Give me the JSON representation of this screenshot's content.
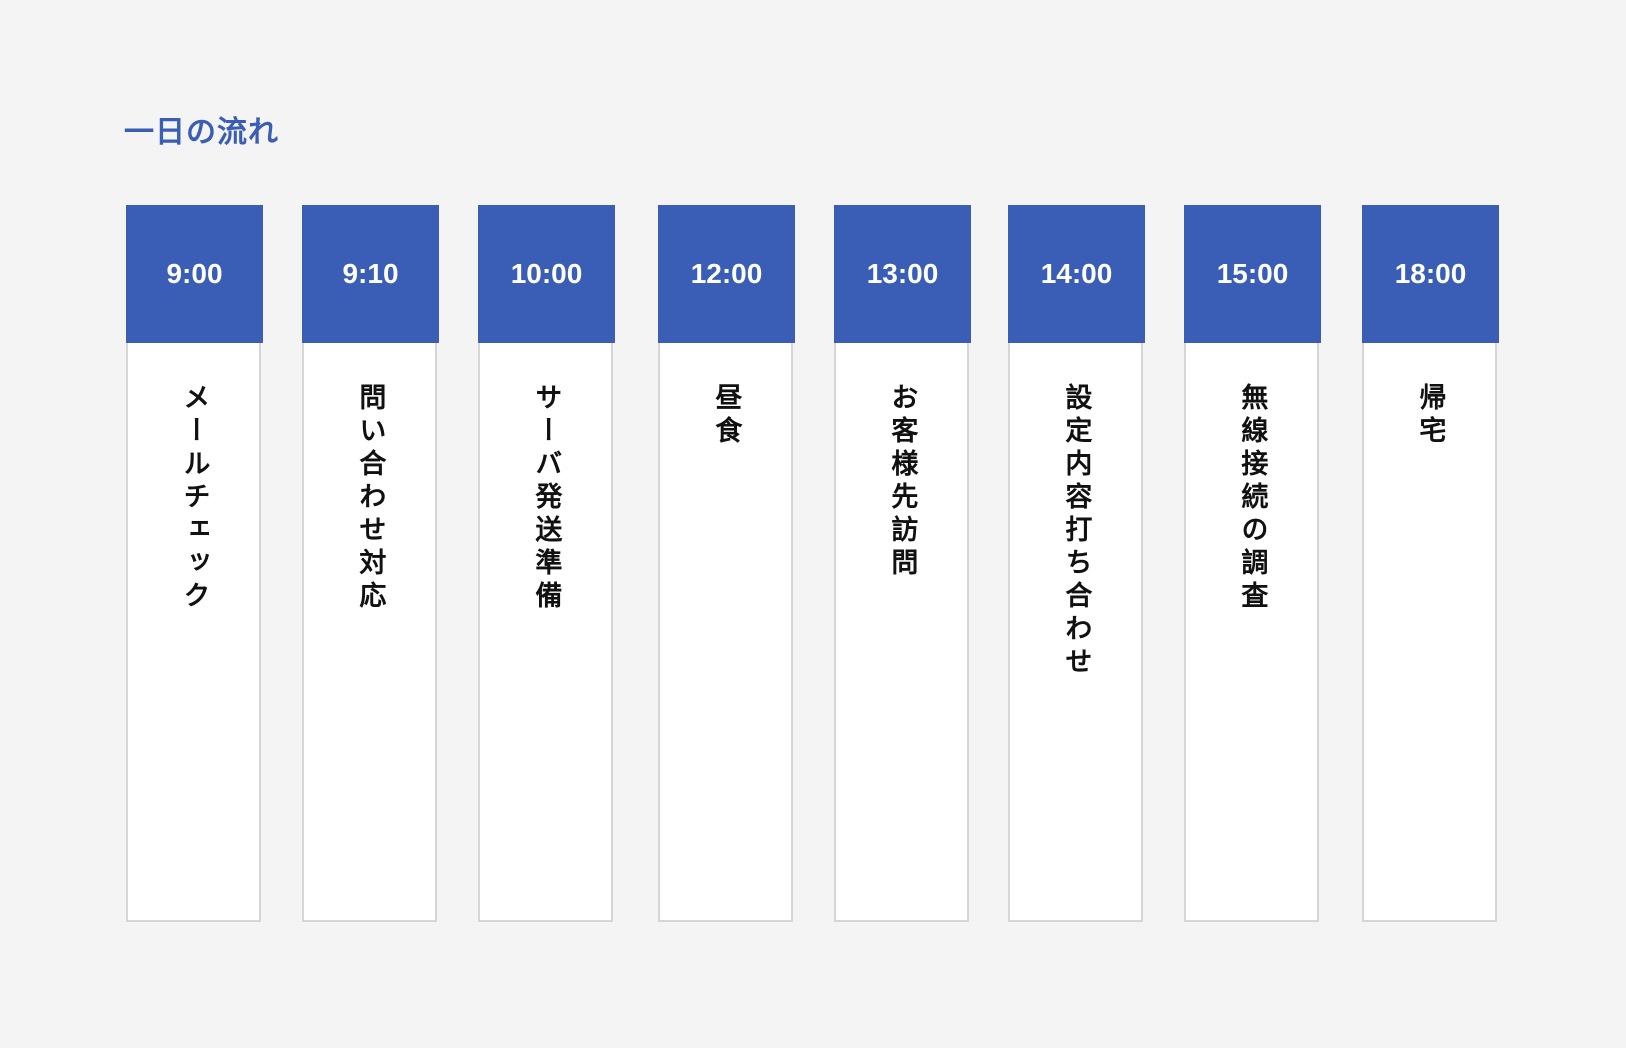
{
  "title": "一日の流れ",
  "colors": {
    "accent": "#3a5db5",
    "background": "#f4f4f4",
    "card": "#ffffff",
    "card_border": "#d6d6d6",
    "text": "#111111"
  },
  "schedule": [
    {
      "time": "9:00",
      "activity": "メールチェック"
    },
    {
      "time": "9:10",
      "activity": "問い合わせ対応"
    },
    {
      "time": "10:00",
      "activity": "サーバ発送準備"
    },
    {
      "time": "12:00",
      "activity": "昼食"
    },
    {
      "time": "13:00",
      "activity": "お客様先訪問"
    },
    {
      "time": "14:00",
      "activity": "設定内容打ち合わせ"
    },
    {
      "time": "15:00",
      "activity": "無線接続の調査"
    },
    {
      "time": "18:00",
      "activity": "帰宅"
    }
  ]
}
